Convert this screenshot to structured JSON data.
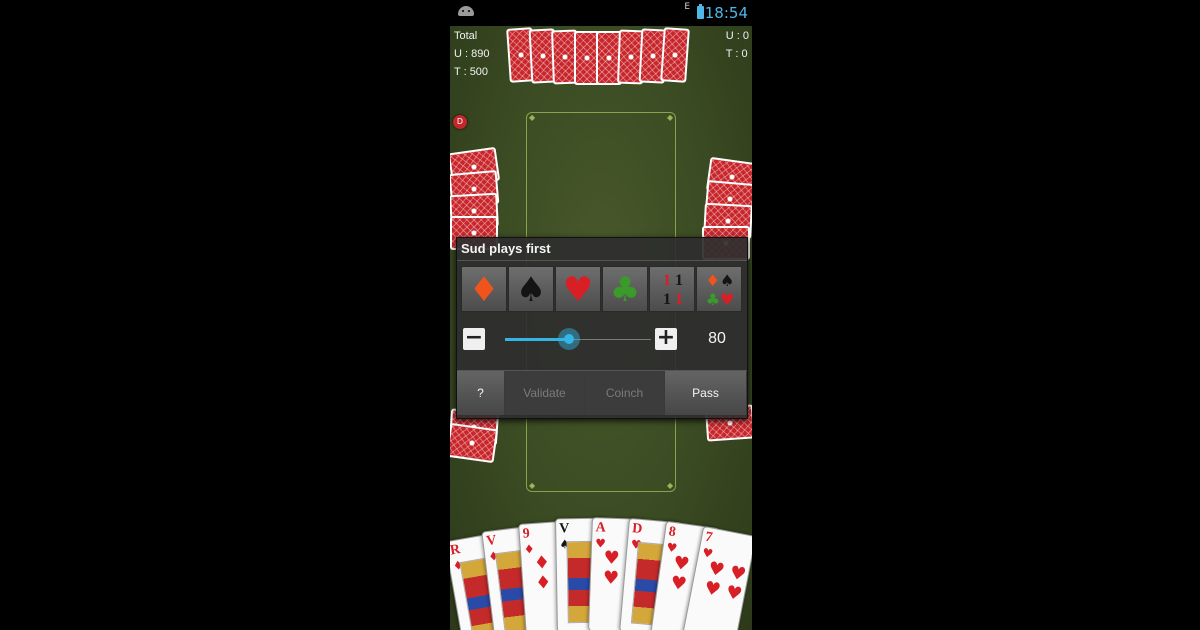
{
  "status_bar": {
    "network": "E",
    "time": "18:54"
  },
  "scores": {
    "left": {
      "title": "Total",
      "us": "U : 890",
      "them": "T : 500"
    },
    "right": {
      "us": "U : 0",
      "them": "T : 0"
    }
  },
  "dealer_badge": "D",
  "dialog": {
    "title": "Sud plays first",
    "trumps": [
      {
        "name": "diamonds",
        "glyph": "♦",
        "color": "#f0531c"
      },
      {
        "name": "spades",
        "glyph": "♠",
        "color": "#141414"
      },
      {
        "name": "hearts",
        "glyph": "♥",
        "color": "#e01e24"
      },
      {
        "name": "clubs",
        "glyph": "♣",
        "color": "#3a9a2a"
      },
      {
        "name": "no-trump",
        "glyph": "1 1\n1 1",
        "color": "#141414"
      },
      {
        "name": "all-trump",
        "glyph": "♦♠\n♣♥",
        "color": "#141414"
      }
    ],
    "minus_label": "−",
    "plus_label": "+",
    "bid": {
      "value": "80",
      "level": 0.44
    },
    "actions": [
      {
        "label": "?",
        "enabled": true
      },
      {
        "label": "Validate",
        "enabled": false
      },
      {
        "label": "Coinch",
        "enabled": false
      },
      {
        "label": "Pass",
        "enabled": true
      }
    ]
  },
  "hand": [
    {
      "rank": "R",
      "suit": "♦",
      "color": "red",
      "face": true
    },
    {
      "rank": "V",
      "suit": "♦",
      "color": "red",
      "face": true
    },
    {
      "rank": "9",
      "suit": "♦",
      "color": "red",
      "face": false
    },
    {
      "rank": "V",
      "suit": "♠",
      "color": "black",
      "face": true
    },
    {
      "rank": "A",
      "suit": "♥",
      "color": "red",
      "face": false
    },
    {
      "rank": "D",
      "suit": "♥",
      "color": "red",
      "face": true
    },
    {
      "rank": "8",
      "suit": "♥",
      "color": "red",
      "face": false
    },
    {
      "rank": "7",
      "suit": "♥",
      "color": "red",
      "face": false
    }
  ]
}
